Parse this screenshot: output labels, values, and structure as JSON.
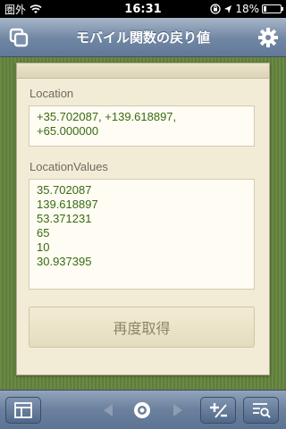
{
  "status_bar": {
    "carrier": "圏外",
    "time": "16:31",
    "battery": "18%",
    "battery_level": 0.18
  },
  "nav": {
    "title": "モバイル関数の戻り値",
    "left_icon": "tabs-icon",
    "right_icon": "gear-icon"
  },
  "card": {
    "location_label": "Location",
    "location_value_lines": [
      "+35.702087, +139.618897,",
      "+65.000000"
    ],
    "location_values_label": "LocationValues",
    "location_values": [
      "35.702087",
      "139.618897",
      "53.371231",
      "65",
      "10",
      "30.937395"
    ],
    "reget_button": "再度取得"
  },
  "toolbar": {
    "icons": [
      "layout-icon",
      "back-arrow-icon",
      "record-icon",
      "forward-arrow-icon",
      "plus-minus-icon",
      "search-list-icon"
    ]
  }
}
